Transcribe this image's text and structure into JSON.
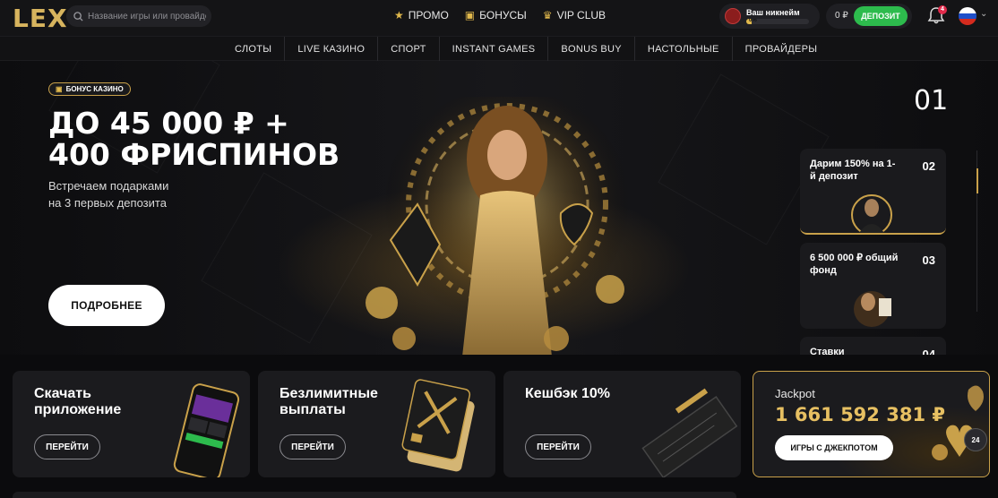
{
  "header": {
    "logo": "LEX",
    "search_placeholder": "Название игры или провайдера",
    "nav": [
      {
        "label": "ПРОМО",
        "icon": "star-icon"
      },
      {
        "label": "БОНУСЫ",
        "icon": "gift-icon"
      },
      {
        "label": "VIP CLUB",
        "icon": "crown-icon"
      }
    ],
    "user": {
      "name": "Ваш никнейм",
      "progress_label": "0%",
      "progress": 0.08
    },
    "balance": "0 ₽",
    "deposit_label": "ДЕПОЗИТ",
    "notifications_count": "4",
    "language_icon": "russia-flag-icon"
  },
  "categories": [
    "СЛОТЫ",
    "LIVE КАЗИНО",
    "СПОРТ",
    "INSTANT GAMES",
    "BONUS BUY",
    "НАСТОЛЬНЫЕ",
    "ПРОВАЙДЕРЫ"
  ],
  "hero": {
    "badge": "БОНУС КАЗИНО",
    "title_line1": "ДО 45 000 ₽ +",
    "title_line2": "400 ФРИСПИНОВ",
    "subtitle_line1": "Встречаем подарками",
    "subtitle_line2": "на 3 первых депозита",
    "button": "ПОДРОБНЕЕ",
    "current_slide": "01"
  },
  "slides": [
    {
      "title": "Дарим 150% на 1-й депозит",
      "number": "02"
    },
    {
      "title": "6 500 000 ₽ общий фонд",
      "number": "03"
    },
    {
      "title": "Ставки",
      "number": "04"
    }
  ],
  "promos": [
    {
      "title": "Скачать приложение",
      "button": "ПЕРЕЙТИ"
    },
    {
      "title": "Безлимитные выплаты",
      "button": "ПЕРЕЙТИ"
    },
    {
      "title": "Кешбэк 10%",
      "button": "ПЕРЕЙТИ"
    }
  ],
  "jackpot": {
    "label": "Jackpot",
    "value": "1 661 592 381 ₽",
    "button": "ИГРЫ С ДЖЕКПОТОМ"
  },
  "support_label": "24",
  "colors": {
    "accent_gold": "#c9a14a",
    "deposit_green": "#2dbb4d",
    "background": "#0b0b0d"
  }
}
